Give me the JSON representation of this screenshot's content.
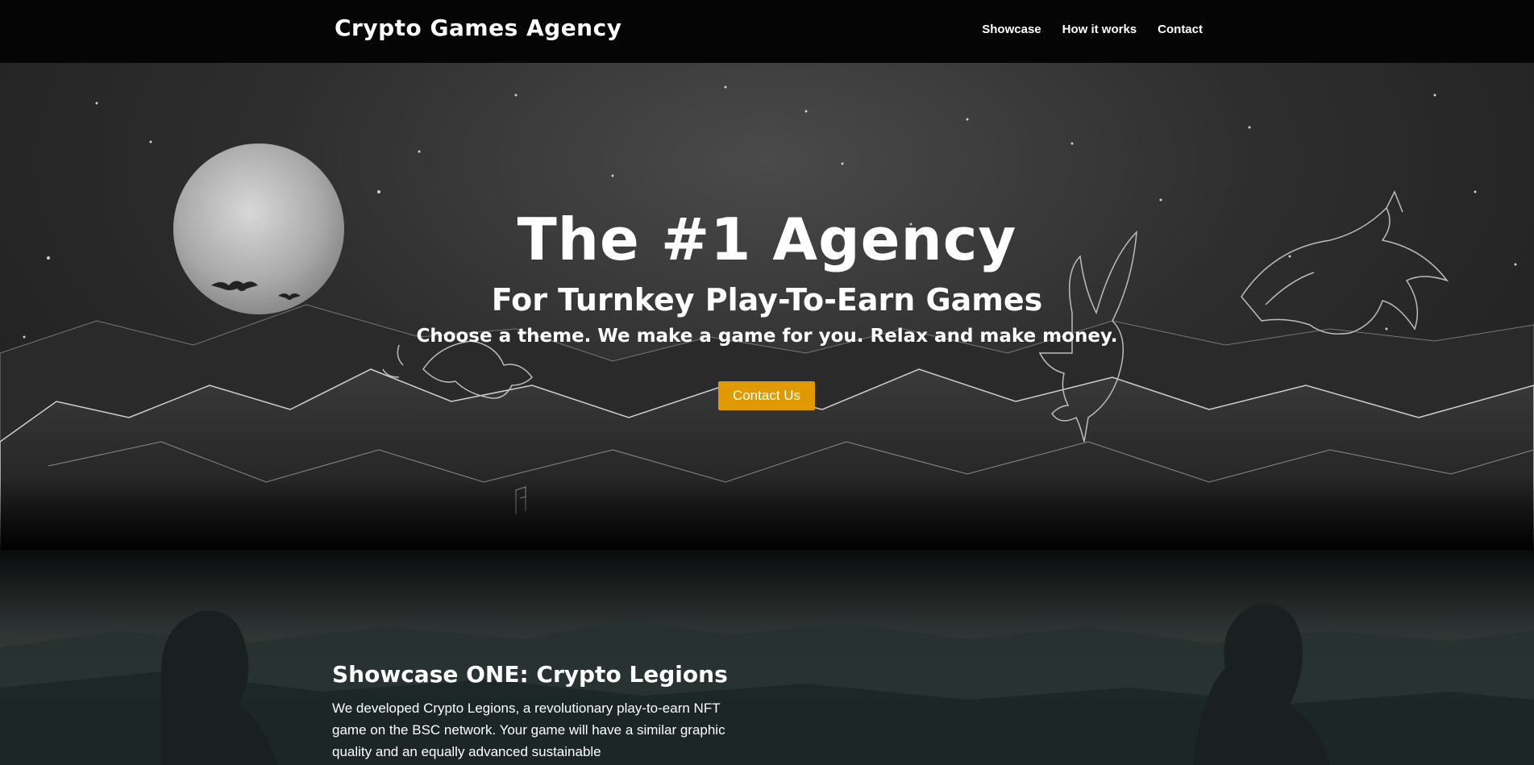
{
  "header": {
    "brand": "Crypto Games Agency",
    "nav": [
      "Showcase",
      "How it works",
      "Contact"
    ]
  },
  "hero": {
    "title": "The #1 Agency",
    "subtitle": "For Turnkey Play-To-Earn Games",
    "tagline": "Choose a theme. We make a game for you. Relax and make money.",
    "cta_label": "Contact Us"
  },
  "showcase": {
    "title": "Showcase ONE: Crypto Legions",
    "text": "We developed Crypto Legions, a revolutionary play-to-earn NFT game on the BSC network. Your game will have a similar graphic quality and an equally advanced sustainable"
  },
  "colors": {
    "accent": "#e09a00",
    "header_bg": "#050505",
    "text": "#ffffff"
  }
}
